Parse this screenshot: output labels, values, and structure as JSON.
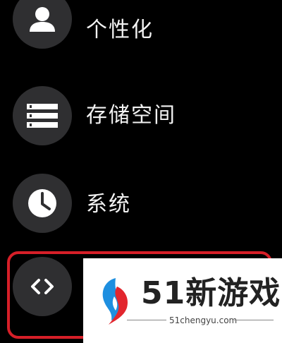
{
  "menu": {
    "items": [
      {
        "label": "个性化",
        "icon": "person-icon"
      },
      {
        "label": "存储空间",
        "icon": "storage-list-icon"
      },
      {
        "label": "系统",
        "icon": "clock-icon"
      },
      {
        "label": "",
        "icon": "code-brackets-icon"
      }
    ]
  },
  "highlight": {
    "color": "#d61f28"
  },
  "watermark": {
    "brand": "51新游戏",
    "url": "51chengyu.com"
  },
  "colors": {
    "background": "#000000",
    "icon_circle": "#2f2f31",
    "text": "#f2f2f2"
  }
}
